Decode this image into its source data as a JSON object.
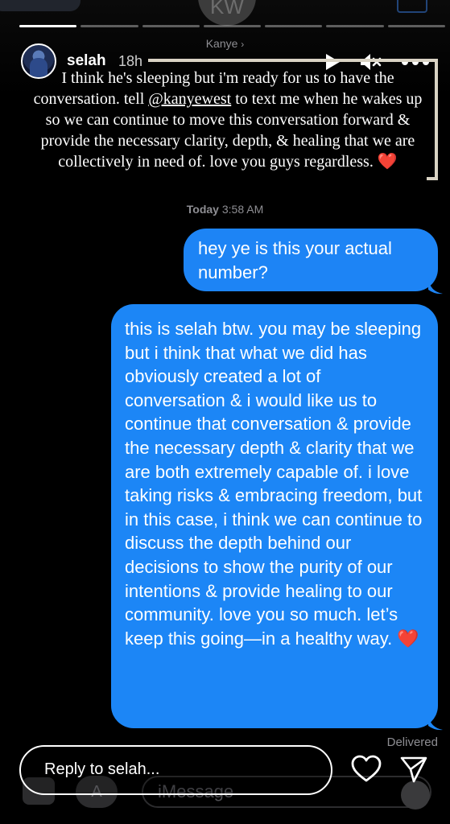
{
  "header": {
    "ghost_avatar_initials": "KW",
    "contact_name": "Kanye"
  },
  "story": {
    "username": "selah",
    "time_ago": "18h",
    "progress_total": 7,
    "progress_done": 1,
    "icons": {
      "play": "play-icon",
      "mute": "mute-icon",
      "more": "more-icon"
    }
  },
  "screenshot_text": {
    "line1": "I think he's sleeping but i'm ready for us to have the conversation. tell",
    "mention": "@kanyewest",
    "line2": "to text me when he wakes up so we can continue to move this conversation forward & provide the necessary clarity, depth, & healing that we are collectively in need of. love you guys regardless.",
    "heart": "❤️"
  },
  "thread": {
    "timestamp_day": "Today",
    "timestamp_time": "3:58 AM",
    "messages": [
      {
        "text": "hey ye is this your actual number?"
      },
      {
        "text": "this is selah btw. you may be sleeping but i think that what we did has obviously created a lot of conversation & i would like us to continue that conversation & provide the necessary depth & clarity that we are both extremely capable of. i love taking risks & embracing freedom, but in this case, i think we can continue to discuss the depth behind our decisions to show the purity of our intentions & provide healing to our community. love you so much. let’s keep this going—in a healthy way.",
        "heart": "❤️"
      }
    ],
    "status": "Delivered"
  },
  "imessage_bar": {
    "placeholder": "iMessage",
    "apps_icon": "A"
  },
  "reply": {
    "placeholder": "Reply to selah...",
    "icons": {
      "like": "heart-icon",
      "send": "send-icon"
    }
  },
  "colors": {
    "bubble": "#1d84f5",
    "background": "#000000",
    "heart": "#e0202e"
  }
}
